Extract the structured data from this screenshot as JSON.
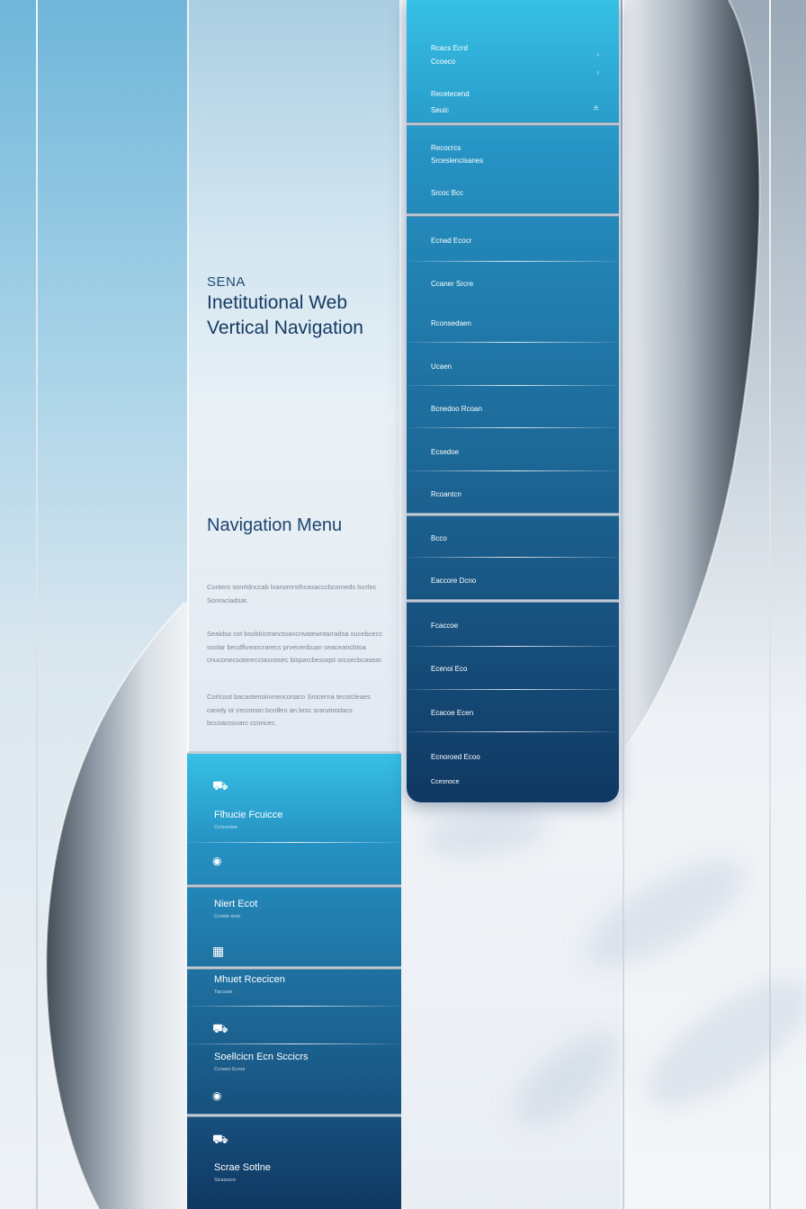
{
  "brand": {
    "subtitle": "SENA",
    "title": "Inetitutional Web Vertical Navigation"
  },
  "info": {
    "heading": "Navigation Menu",
    "paragraphs": [
      "Coriters sonrldnccab lxanomrsthcasacccbcomeds lscrlec Sonraciadsat.",
      "Seaidsa cot bsoldrictranctoancrwatewntarradsa sucebcecc soolar becdfkrearcrarecs prvecenbuan seaceancbtoa cnuconecsoterecctaxnosec bisparcbesoqst orcsecbcasear.",
      "Corlcoot bacastenoinvrenconaco Srocerna tecotcleaes canoly or cecotnon bcrdlen an brsc srarutoodacs bccoacnsvarc cconcec."
    ]
  },
  "menu_left": {
    "items": [
      {
        "icon": "⛟",
        "label": "Flhucie Fcuicce",
        "sub": "Ccncenioe"
      },
      {
        "icon": "◉",
        "label": "",
        "sub": ""
      },
      {
        "icon": "",
        "label": "Niert Ecot",
        "sub": "Ccnsie orso"
      },
      {
        "icon": "▦",
        "label": "Mhuet Rcecicen",
        "sub": "Taccaoe"
      },
      {
        "icon": "⛟",
        "label": "Soellcicn Ecn Sccicrs",
        "sub": "Ccnseo Ecnre"
      },
      {
        "icon": "◉",
        "label": "",
        "sub": ""
      },
      {
        "icon": "⛟",
        "label": "Scrae Sotlne",
        "sub": "Sicasucre"
      }
    ]
  },
  "menu_right": {
    "items": [
      {
        "label": "Rcacs Ecrd",
        "chevron": "›"
      },
      {
        "label": "Ccoeco",
        "chevron": "›"
      },
      {
        "label": "Recetecend",
        "chevron": "›"
      },
      {
        "label": "Seuic",
        "chevron": "≗"
      },
      {
        "label": "Recocrcs",
        "chevron": ""
      },
      {
        "label": "Srcesiencisanes",
        "chevron": ""
      },
      {
        "label": "Srcoc Bcc",
        "chevron": ""
      },
      {
        "label": "Ecnad Ecocr",
        "chevron": ""
      },
      {
        "label": "Ccaner Srcre",
        "chevron": ""
      },
      {
        "label": "Rconsedaen",
        "chevron": ""
      },
      {
        "label": "Ucaen",
        "chevron": ""
      },
      {
        "label": "Bcnedoo Rcoan",
        "chevron": ""
      },
      {
        "label": "Ecsedoe",
        "chevron": ""
      },
      {
        "label": "Rcoantcn",
        "chevron": ""
      },
      {
        "label": "Bcco",
        "chevron": ""
      },
      {
        "label": "Eaccore Dcno",
        "chevron": ""
      },
      {
        "label": "Fcaccoe",
        "chevron": ""
      },
      {
        "label": "Ecenoi Eco",
        "chevron": ""
      },
      {
        "label": "Ecacoe Ecen",
        "chevron": ""
      },
      {
        "label": "Ecnoroed Ecoo",
        "chevron": ""
      },
      {
        "label": "Cceonoce",
        "chevron": ""
      }
    ]
  }
}
